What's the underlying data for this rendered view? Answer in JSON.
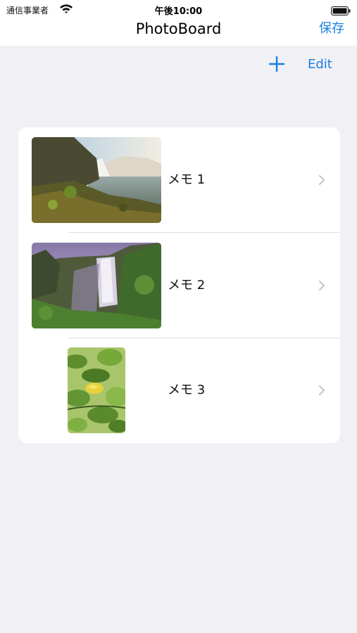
{
  "status_bar": {
    "carrier": "通信事業者",
    "time": "午後10:00"
  },
  "nav": {
    "title": "PhotoBoard",
    "save_label": "保存"
  },
  "toolbar": {
    "add_icon": "plus-icon",
    "edit_label": "Edit"
  },
  "memos": [
    {
      "label": "メモ 1",
      "thumbnail": "waterfall-landscape"
    },
    {
      "label": "メモ 2",
      "thumbnail": "waterfall-cliff"
    },
    {
      "label": "メモ 3",
      "thumbnail": "leaves-with-lemon"
    }
  ],
  "colors": {
    "accent": "#1a7fe0",
    "background": "#f0f0f5",
    "card": "#ffffff",
    "separator": "#dedee3",
    "chevron": "#c4c4c9"
  }
}
